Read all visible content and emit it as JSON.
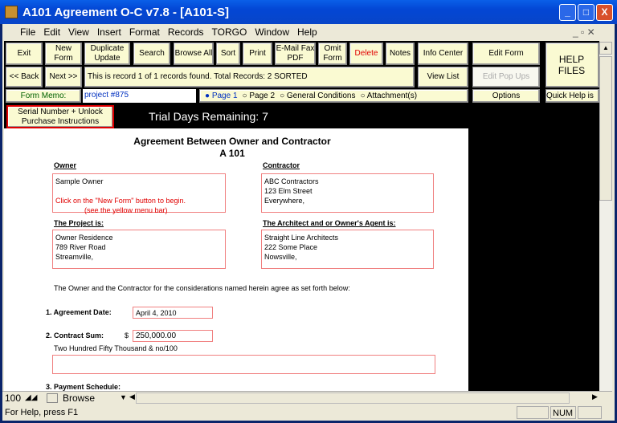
{
  "window": {
    "title": "A101 Agreement O-C v7.8 - [A101-S]",
    "controls": [
      "_",
      "□",
      "X"
    ]
  },
  "menu": [
    "File",
    "Edit",
    "View",
    "Insert",
    "Format",
    "Records",
    "TORGO",
    "Window",
    "Help"
  ],
  "toolbar": {
    "exit": "Exit",
    "new_form": "New Form",
    "duplicate": "Duplicate Update",
    "search": "Search",
    "browse_all": "Browse All",
    "sort": "Sort",
    "print": "Print",
    "email": "E-Mail Fax  PDF",
    "omit": "Omit Form",
    "delete": "Delete",
    "notes": "Notes",
    "info_center": "Info Center",
    "edit_form": "Edit Form",
    "help_files": "HELP FILES",
    "back": "<< Back",
    "next": "Next >>",
    "record_msg": "This is record 1 of 1 records found.   Total Records: 2   SORTED",
    "view_list": "View List",
    "edit_popups": "Edit Pop Ups",
    "form_memo_label": "Form Memo:",
    "form_memo_value": "project #875",
    "pages": [
      "Page 1",
      "Page 2",
      "General Conditions",
      "Attachment(s)"
    ],
    "selected_page": "Page 1",
    "options": "Options",
    "quick_help": "Quick Help is"
  },
  "serial_button": "Serial Number + Unlock Purchase Instructions",
  "trial": "Trial Days Remaining: 7",
  "form": {
    "title": "Agreement Between Owner and Contractor",
    "subtitle": "A 101",
    "owner_label": "Owner",
    "owner_lines": [
      "Sample Owner"
    ],
    "owner_hint1": "Click on the \"New Form\" button to begin.",
    "owner_hint2": "(see the yellow menu bar)",
    "contractor_label": "Contractor",
    "contractor_lines": [
      "ABC Contractors",
      "123 Elm Street",
      "Everywhere,"
    ],
    "project_label": "The Project is:",
    "project_lines": [
      "Owner Residence",
      "789 River Road",
      "Streamville,"
    ],
    "architect_label": "The Architect and or Owner's Agent is:",
    "architect_lines": [
      "Straight Line Architects",
      "222 Some Place",
      "Nowsville,"
    ],
    "intro": "The Owner and the Contractor for the considerations named herein agree as set forth below:",
    "date_label": "1. Agreement Date:",
    "date_value": "April 4, 2010",
    "sum_label": "2. Contract Sum:",
    "currency": "$",
    "sum_value": "250,000.00",
    "sum_words": "Two Hundred Fifty Thousand & no/100",
    "payment_label": "3. Payment Schedule:"
  },
  "bottom": {
    "zoom": "100",
    "mode": "Browse"
  },
  "status": {
    "help": "For Help, press F1",
    "num": "NUM"
  }
}
